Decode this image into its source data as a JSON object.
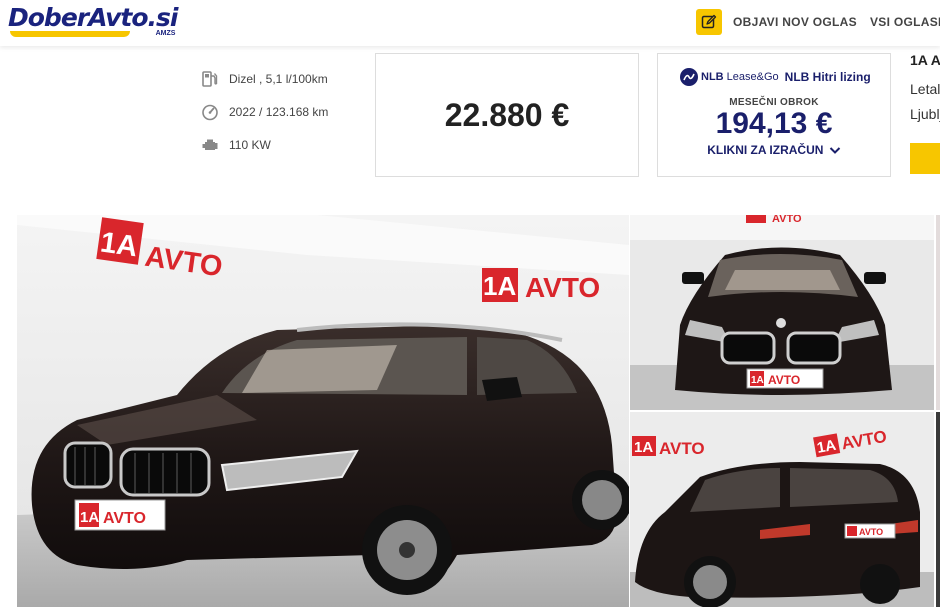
{
  "header": {
    "logo_text": "DoberAvto.si",
    "logo_sub": "AMZS",
    "nav": [
      {
        "label": "OBJAVI NOV OGLAS"
      },
      {
        "label": "VSI OGLASI"
      }
    ]
  },
  "specs": [
    {
      "icon": "fuel-pump-icon",
      "text": "Dizel , 5,1 l/100km"
    },
    {
      "icon": "speedometer-icon",
      "text": "2022 / 123.168 km"
    },
    {
      "icon": "engine-icon",
      "text": "110 KW"
    }
  ],
  "price": "22.880 €",
  "leasing": {
    "brand_prefix": "NLB",
    "brand_suffix": "Lease&Go",
    "title": "NLB Hitri lizing",
    "label": "MESEČNI OBROK",
    "amount": "194,13 €",
    "cta": "KLIKNI ZA IZRAČUN"
  },
  "dealer": {
    "name": "1A A",
    "line1": "Letal",
    "line2": "Ljublj"
  },
  "gallery": {
    "watermark": "1A AVTO",
    "plate": "1A AVTO"
  },
  "colors": {
    "brand_blue": "#1a237e",
    "accent_yellow": "#f7c600",
    "nlb_blue": "#1a1f6b"
  }
}
